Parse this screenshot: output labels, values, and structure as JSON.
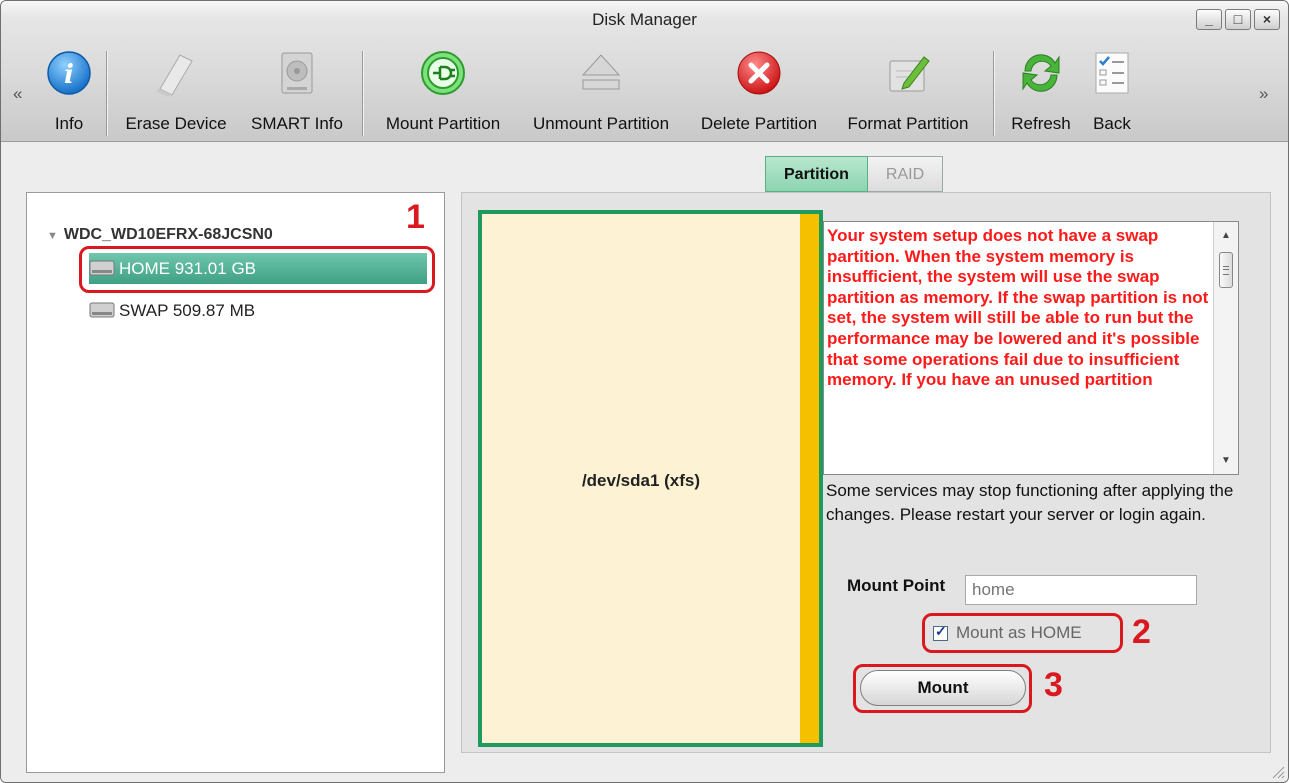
{
  "window": {
    "title": "Disk Manager"
  },
  "toolbar": {
    "nav_left": "«",
    "nav_right": "»",
    "items": [
      {
        "label": "Info",
        "icon": "info-icon"
      },
      {
        "label": "Erase Device",
        "icon": "eraser-icon"
      },
      {
        "label": "SMART Info",
        "icon": "hard-disk-icon"
      },
      {
        "label": "Mount Partition",
        "icon": "plug-icon"
      },
      {
        "label": "Unmount Partition",
        "icon": "eject-icon"
      },
      {
        "label": "Delete Partition",
        "icon": "delete-x-icon"
      },
      {
        "label": "Format Partition",
        "icon": "format-pen-icon"
      },
      {
        "label": "Refresh",
        "icon": "refresh-icon"
      },
      {
        "label": "Back",
        "icon": "checklist-icon"
      }
    ]
  },
  "tabs": [
    {
      "label": "Partition",
      "active": true
    },
    {
      "label": "RAID",
      "active": false
    }
  ],
  "tree": {
    "device": "WDC_WD10EFRX-68JCSN0",
    "partitions": [
      {
        "label": "HOME 931.01 GB",
        "selected": true
      },
      {
        "label": "SWAP 509.87 MB",
        "selected": false
      }
    ]
  },
  "partition_view": {
    "label": "/dev/sda1 (xfs)"
  },
  "warning": {
    "text": "Your system setup does not have a swap partition. When the system memory is insufficient, the system will use the swap partition as memory. If the swap partition is not set, the system will still be able to run but the performance may be lowered and it's possible that some operations fail due to insufficient memory. If you have an unused partition"
  },
  "note": "Some services may stop functioning after applying the changes. Please restart your server or login again.",
  "mount": {
    "point_label": "Mount Point",
    "point_placeholder": "home",
    "as_home_label": "Mount as HOME",
    "as_home_checked": true,
    "button_label": "Mount"
  },
  "annotations": [
    "1",
    "2",
    "3"
  ],
  "colors": {
    "accent_green": "#1e9a5f",
    "selection_teal": "#3f9f84",
    "warning_red": "#ff1a1a",
    "annotation_red": "#d9191f",
    "partition_fill": "#fdf3d4",
    "partition_bar": "#f5c000"
  }
}
